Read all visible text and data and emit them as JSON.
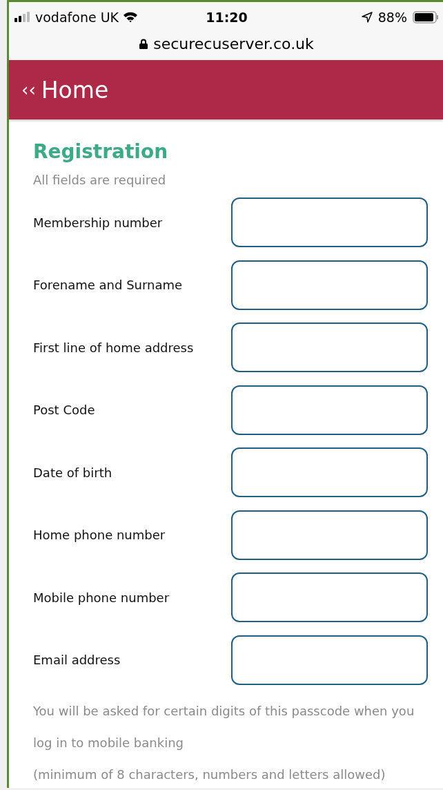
{
  "status_bar": {
    "carrier": "vodafone UK",
    "time": "11:20",
    "battery": "88%"
  },
  "address_bar": {
    "url": "securecuserver.co.uk"
  },
  "header": {
    "back_icon": "‹‹",
    "title": "Home"
  },
  "form": {
    "title": "Registration",
    "subtitle": "All fields are required",
    "fields": [
      {
        "label": "Membership number"
      },
      {
        "label": "Forename and Surname"
      },
      {
        "label": "First line of home address"
      },
      {
        "label": "Post Code"
      },
      {
        "label": "Date of birth"
      },
      {
        "label": "Home phone number"
      },
      {
        "label": "Mobile phone number"
      },
      {
        "label": "Email address"
      }
    ],
    "notes": [
      "You will be asked for certain digits of this passcode when you log in to mobile banking",
      "(minimum of 8 characters, numbers and letters allowed)"
    ]
  }
}
